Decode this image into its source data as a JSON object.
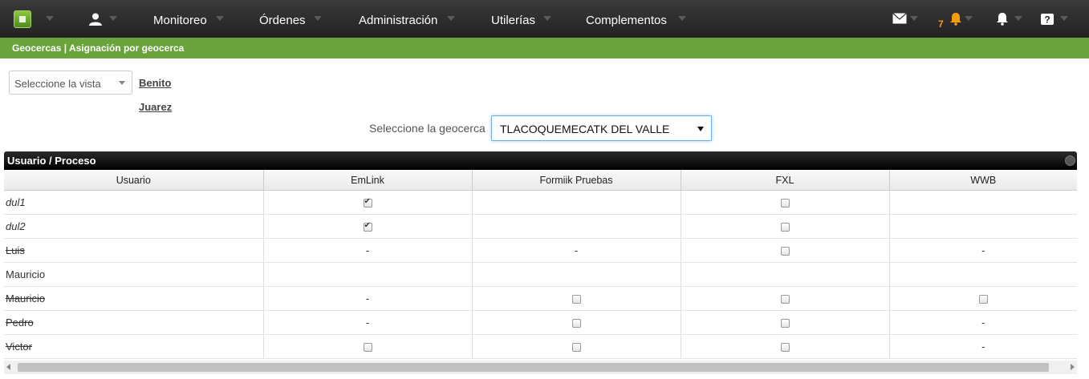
{
  "navbar": {
    "items": [
      {
        "label": "Monitoreo"
      },
      {
        "label": "Órdenes"
      },
      {
        "label": "Administración"
      },
      {
        "label": "Utilerías"
      },
      {
        "label": "Complementos"
      }
    ],
    "alert_count": "7",
    "alert_color": "#f39c12"
  },
  "breadcrumb": "Geocercas | Asignación por geocerca",
  "view_select": {
    "value": "Seleccione la vista"
  },
  "place_link": {
    "line1": "Benito",
    "line2": "Juarez"
  },
  "geocerca": {
    "label": "Seleccione la geocerca",
    "value": "TLACOQUEMECATK DEL VALLE"
  },
  "panel": {
    "title": "Usuario / Proceso"
  },
  "table": {
    "headers": [
      "Usuario",
      "EmLink",
      "Formiik Pruebas",
      "FXL",
      "WWB"
    ],
    "rows": [
      {
        "user": "dul1",
        "style": "italic",
        "cells": [
          "checked",
          "",
          "unchecked",
          ""
        ]
      },
      {
        "user": "dul2",
        "style": "italic",
        "cells": [
          "checked",
          "",
          "unchecked",
          ""
        ]
      },
      {
        "user": "Luis",
        "style": "strike",
        "cells": [
          "-",
          "-",
          "unchecked",
          "-"
        ]
      },
      {
        "user": "Mauricio",
        "style": "normal",
        "cells": [
          "",
          "",
          "",
          ""
        ]
      },
      {
        "user": "Mauricio",
        "style": "strike",
        "cells": [
          "-",
          "unchecked",
          "unchecked",
          "unchecked"
        ]
      },
      {
        "user": "Pedro",
        "style": "strike",
        "cells": [
          "-",
          "unchecked",
          "unchecked",
          "-"
        ]
      },
      {
        "user": "Victor",
        "style": "strike",
        "cells": [
          "unchecked",
          "unchecked",
          "unchecked",
          "-"
        ]
      }
    ]
  },
  "colors": {
    "navbar": "#2a2a2a",
    "breadcrumb_bar": "#6aa33b",
    "panel_header": "#000000"
  }
}
